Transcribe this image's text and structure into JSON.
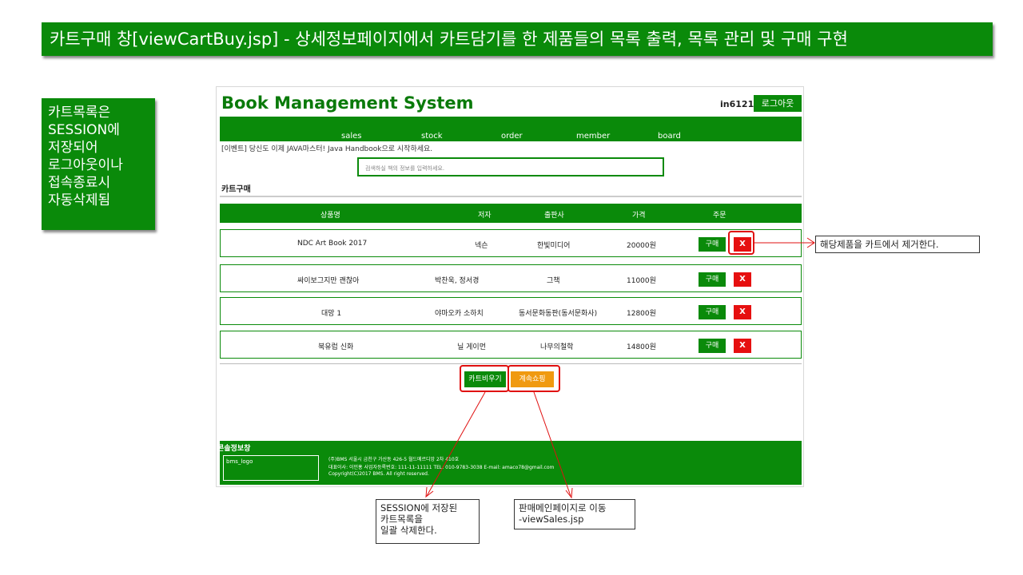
{
  "banner": {
    "text": "카트구매 창[viewCartBuy.jsp] - 상세정보페이지에서 카트담기를 한 제품들의 목록 출력, 목록 관리 및 구매 구현"
  },
  "side_note": {
    "text": "카트목록은\nSESSION에\n저장되어\n로그아웃이나\n접속종료시\n자동삭제됨"
  },
  "app": {
    "title": "Book Management System",
    "user_id": "in6121",
    "logout_label": "로그아웃",
    "nav": [
      "sales",
      "stock",
      "order",
      "member",
      "board"
    ],
    "event_text": "[이벤트] 당신도 이제 JAVA마스터! Java Handbook으로 시작하세요.",
    "search_placeholder": "검색하실 책의 정보를 입력하세요.",
    "section_title": "카트구매",
    "columns": [
      "상품명",
      "저자",
      "출판사",
      "가격",
      "주문"
    ],
    "rows": [
      {
        "title": "NDC Art Book 2017",
        "author": "넥슨",
        "publisher": "한빛미디어",
        "price": "20000원"
      },
      {
        "title": "싸이보그지만 괜찮아",
        "author": "박찬욱, 정서경",
        "publisher": "그책",
        "price": "11000원"
      },
      {
        "title": "대망 1",
        "author": "야마오카 소하치",
        "publisher": "동서문화동판(동서문화사)",
        "price": "12800원"
      },
      {
        "title": "북유럽 신화",
        "author": "닐 게이먼",
        "publisher": "나무의철학",
        "price": "14800원"
      }
    ],
    "buy_label": "구매",
    "delete_label": "X",
    "empty_cart_label": "카트비우기",
    "continue_label": "계속쇼핑",
    "footer": {
      "title": "콘솔정보창",
      "logo": "bms_logo",
      "lines": [
        "(주)BMS 서울시 금천구 가산동 426-5 월드메르디앙 2차 410호",
        "대표이사: 이민홍 사업자등록번호: 111-11-11111 TEL: 010-9783-3038 E-mail: amaco78@gmail.com",
        "Copyright(C)2017 BMS. All right reserved."
      ]
    }
  },
  "callouts": {
    "remove": "해당제품을 카트에서 제거한다.",
    "empty": "SESSION에 저장된\n카트목록을\n일괄 삭제한다.",
    "continue": "판매메인페이지로 이동\n-viewSales.jsp"
  },
  "colors": {
    "brand_green": "#0a8a0a",
    "delete_red": "#e61010",
    "continue_orange": "#f09a10",
    "annotation_red": "#e01010"
  }
}
